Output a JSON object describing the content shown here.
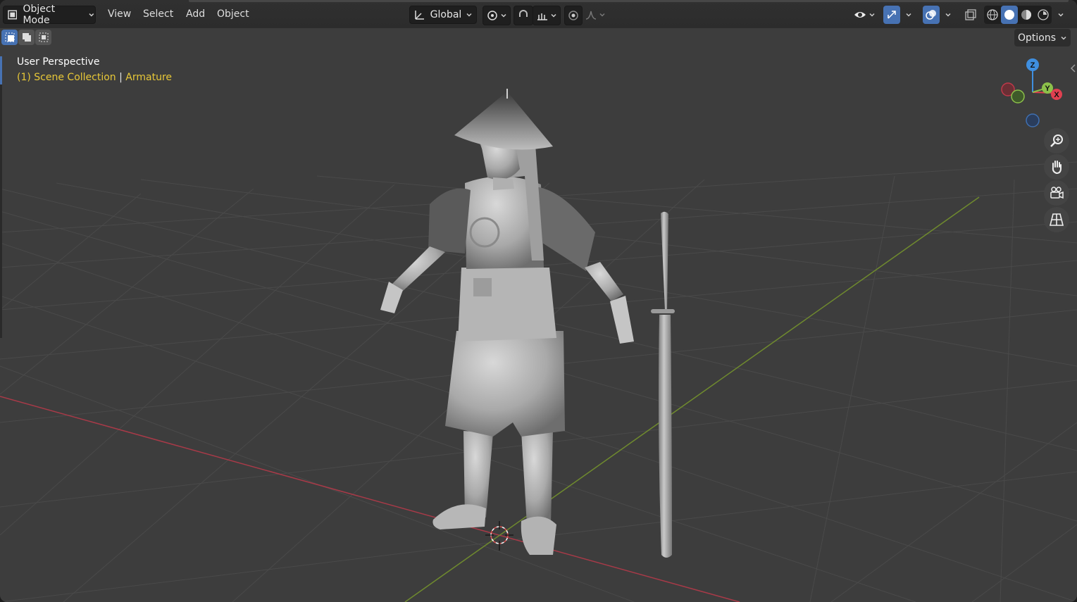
{
  "header": {
    "mode_label": "Object Mode",
    "menus": [
      "View",
      "Select",
      "Add",
      "Object"
    ],
    "orientation_label": "Global",
    "options_label": "Options"
  },
  "overlay": {
    "view_name": "User Perspective",
    "context_prefix": "(1) Scene Collection",
    "context_separator": "|",
    "context_object": "Armature"
  },
  "gizmo": {
    "z": "Z",
    "y": "Y",
    "x": "X"
  },
  "icons": {
    "mode": "object-mode-icon",
    "orientation": "transform-orientation-icon",
    "pivot": "pivot-point-icon",
    "snap": "snap-magnet-icon",
    "snap_target": "snap-increment-icon",
    "proportional": "proportional-edit-icon",
    "falloff": "falloff-curve-icon",
    "visibility": "eye-visibility-icon",
    "gizmos": "gizmo-icon",
    "overlays": "overlay-icon",
    "xray": "xray-toggle-icon",
    "shading": [
      "wireframe-shading-icon",
      "solid-shading-icon",
      "material-shading-icon",
      "rendered-shading-icon"
    ],
    "nav": [
      "zoom-icon",
      "pan-hand-icon",
      "camera-view-icon",
      "ortho-grid-icon"
    ]
  },
  "colors": {
    "viewport_bg": "#3d3d3d",
    "header_bg": "#2c2c2c",
    "active_blue": "#4772b3",
    "context_yellow": "#e8c837",
    "axis_x_red": "#e04050",
    "axis_y_green": "#8cc04a",
    "axis_z_blue": "#3f8fe0"
  }
}
